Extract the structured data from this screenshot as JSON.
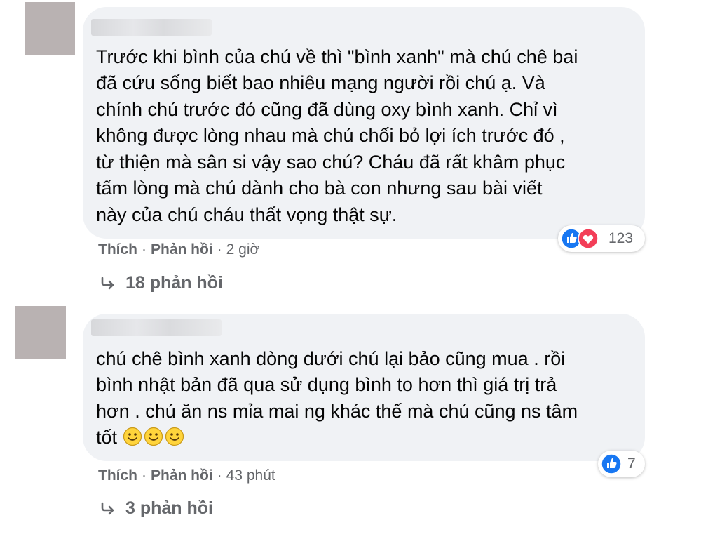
{
  "comments": [
    {
      "lines": [
        "Trước khi bình của chú về thì \"bình xanh\" mà chú chê bai",
        "đã cứu sống biết bao nhiêu mạng người rồi chú ạ. Và",
        "chính chú trước đó cũng đã dùng oxy bình xanh. Chỉ vì",
        "không được lòng nhau mà chú chối bỏ lợi ích trước đó ,",
        "từ thiện mà sân si vậy sao chú? Cháu đã rất khâm phục",
        "tấm lòng mà chú dành cho bà con nhưng sau bài viết",
        "này của chú cháu thất vọng thật sự."
      ],
      "reaction_count": "123",
      "reaction_icons": [
        "like-icon",
        "love-icon"
      ],
      "like_label": "Thích",
      "reply_label": "Phản hồi",
      "separator": "·",
      "time": "2 giờ",
      "replies_text": "18 phản hồi"
    },
    {
      "lines": [
        "chú chê bình xanh dòng dưới chú lại bảo cũng mua . rồi",
        "bình nhật bản đã qua sử dụng bình to hơn thì giá trị trả",
        "hơn . chú ăn ns mỉa mai ng khác thế mà chú cũng ns tâm",
        "tốt"
      ],
      "emoji": [
        "smiley-emoji",
        "smiley-emoji",
        "smiley-emoji"
      ],
      "reaction_count": "7",
      "reaction_icons": [
        "like-icon"
      ],
      "like_label": "Thích",
      "reply_label": "Phản hồi",
      "separator": "·",
      "time": "43 phút",
      "replies_text": "3 phản hồi"
    }
  ],
  "colors": {
    "bubble": "#f0f2f5",
    "meta_text": "#65676b",
    "like_blue": "#1877f2",
    "love_red": "#f33e58",
    "avatar_placeholder": "#b9b2b2"
  }
}
